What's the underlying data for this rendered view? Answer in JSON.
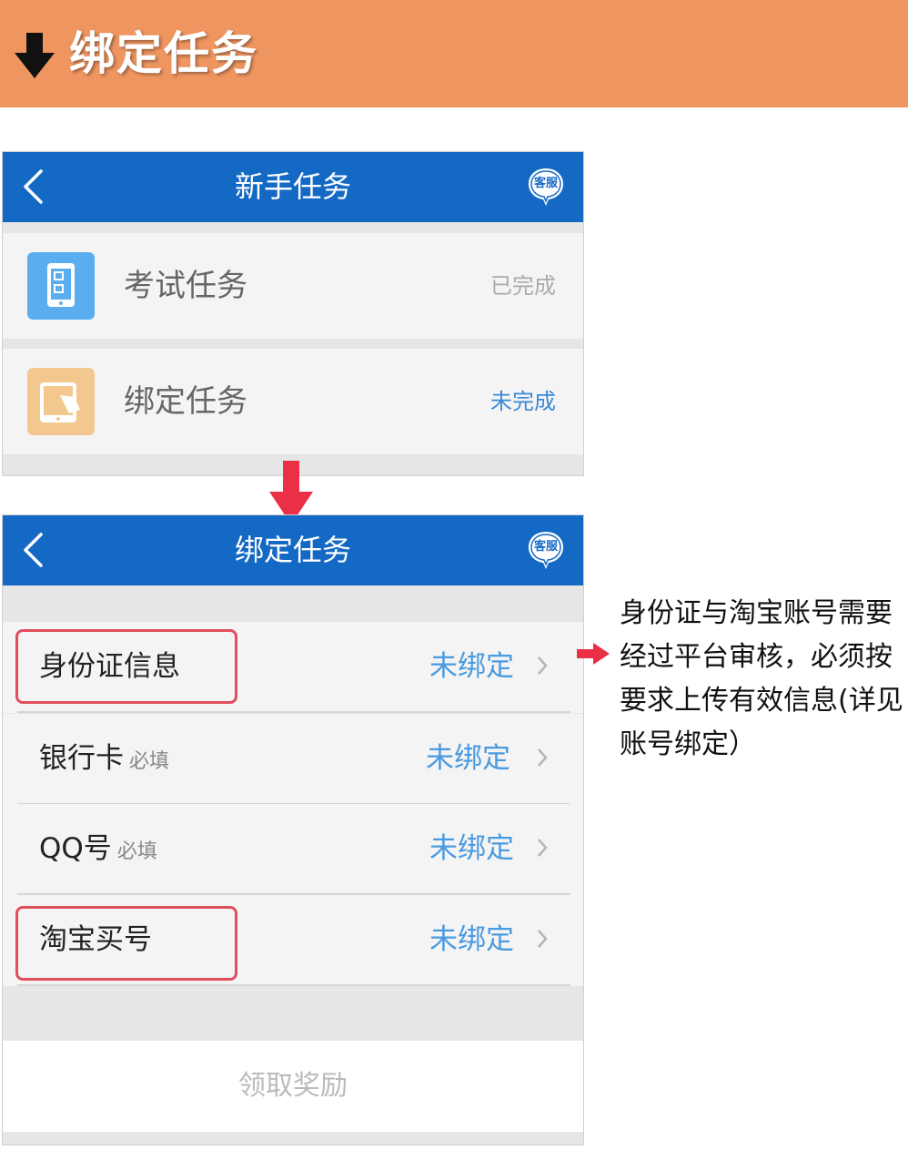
{
  "banner": {
    "title": "绑定任务",
    "icon": "down-arrow-icon"
  },
  "screen1": {
    "nav": {
      "title": "新手任务",
      "service_label": "客服"
    },
    "tasks": [
      {
        "label": "考试任务",
        "status": "已完成",
        "icon": "tablet-checklist-icon"
      },
      {
        "label": "绑定任务",
        "status": "未完成",
        "icon": "tablet-touch-icon"
      }
    ]
  },
  "screen2": {
    "nav": {
      "title": "绑定任务",
      "service_label": "客服"
    },
    "items": [
      {
        "label": "身份证信息",
        "required": "",
        "status": "未绑定"
      },
      {
        "label": "银行卡",
        "required": "必填",
        "status": "未绑定"
      },
      {
        "label": "QQ号",
        "required": "必填",
        "status": "未绑定"
      },
      {
        "label": "淘宝买号",
        "required": "",
        "status": "未绑定"
      }
    ],
    "claim_button": "领取奖励"
  },
  "annotation": {
    "lines": [
      "身份证与淘宝账号需要",
      "经过平台审核，必须按",
      "要求上传有效信息(详见",
      "账号绑定）"
    ]
  },
  "colors": {
    "banner": "#ef9560",
    "nav": "#1469c5",
    "status_link": "#4a9ae0",
    "highlight": "#e24e5c"
  }
}
